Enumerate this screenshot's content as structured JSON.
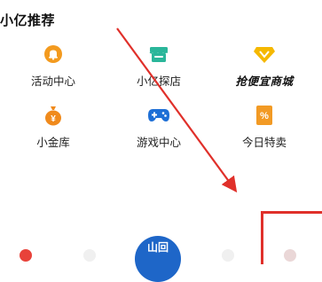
{
  "section": {
    "title": "小亿推荐"
  },
  "items": [
    {
      "label": "活动中心",
      "icon": "bell-icon",
      "color": "#f39a1e"
    },
    {
      "label": "小亿探店",
      "icon": "store-icon",
      "color": "#2ab69a"
    },
    {
      "label": "抢便宜商城",
      "icon": "diamond-icon",
      "color": "#f5b800"
    },
    {
      "label": "小金库",
      "icon": "money-bag-icon",
      "color": "#f08a1c"
    },
    {
      "label": "游戏中心",
      "icon": "gamepad-icon",
      "color": "#1e6fd6"
    },
    {
      "label": "今日特卖",
      "icon": "percent-tag-icon",
      "color": "#f29a24"
    }
  ],
  "bottom": {
    "center_badge_text": "山回"
  },
  "annotation": {
    "color": "#e0302a"
  }
}
